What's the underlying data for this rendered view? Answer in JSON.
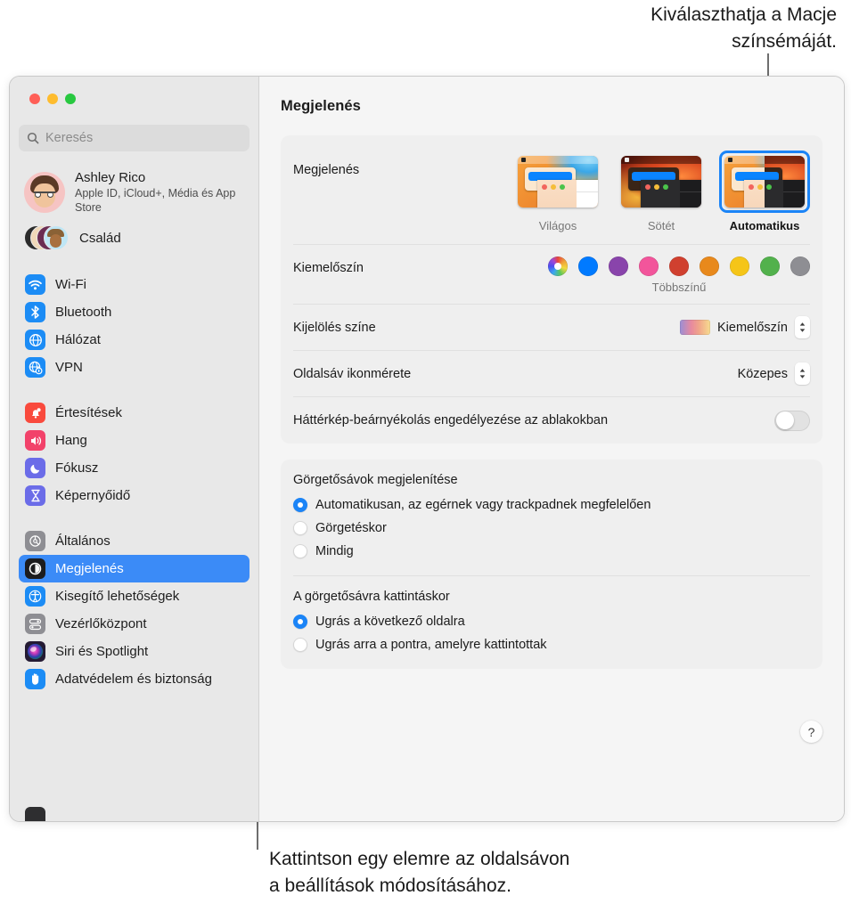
{
  "callouts": {
    "top_line1": "Kiválaszthatja a Macje",
    "top_line2": "színsémáját.",
    "bottom_line1": "Kattintson egy elemre az oldalsávon",
    "bottom_line2": "a beállítások módosításához."
  },
  "window": {
    "title": "Megjelenés"
  },
  "sidebar": {
    "search_placeholder": "Keresés",
    "account": {
      "name": "Ashley Rico",
      "subtitle": "Apple ID, iCloud+, Média és App Store"
    },
    "family_label": "Család",
    "groups": [
      {
        "items": [
          {
            "label": "Wi-Fi",
            "icon": "wifi-icon",
            "color": "#1c8cf5"
          },
          {
            "label": "Bluetooth",
            "icon": "bluetooth-icon",
            "color": "#1c8cf5"
          },
          {
            "label": "Hálózat",
            "icon": "globe-icon",
            "color": "#1c8cf5"
          },
          {
            "label": "VPN",
            "icon": "vpn-globe-icon",
            "color": "#1c8cf5"
          }
        ]
      },
      {
        "items": [
          {
            "label": "Értesítések",
            "icon": "bell-icon",
            "color": "#f94a3d"
          },
          {
            "label": "Hang",
            "icon": "speaker-icon",
            "color": "#f2426a"
          },
          {
            "label": "Fókusz",
            "icon": "moon-icon",
            "color": "#6b6ce8"
          },
          {
            "label": "Képernyőidő",
            "icon": "hourglass-icon",
            "color": "#6b6ce8"
          }
        ]
      },
      {
        "items": [
          {
            "label": "Általános",
            "icon": "gear-icon",
            "color": "#8e8e93"
          },
          {
            "label": "Megjelenés",
            "icon": "appearance-icon",
            "color": "#1c1c1e",
            "selected": true
          },
          {
            "label": "Kisegítő lehetőségek",
            "icon": "accessibility-icon",
            "color": "#1c8cf5"
          },
          {
            "label": "Vezérlőközpont",
            "icon": "control-center-icon",
            "color": "#8e8e93"
          },
          {
            "label": "Siri és Spotlight",
            "icon": "siri-icon",
            "color": "#2b1f3b"
          },
          {
            "label": "Adatvédelem és biztonság",
            "icon": "hand-icon",
            "color": "#1c8cf5"
          }
        ]
      }
    ]
  },
  "main": {
    "appearance": {
      "label": "Megjelenés",
      "options": [
        {
          "name": "Világos",
          "selected": false
        },
        {
          "name": "Sötét",
          "selected": false
        },
        {
          "name": "Automatikus",
          "selected": true
        }
      ]
    },
    "accent": {
      "label": "Kiemelőszín",
      "caption": "Többszínű",
      "colors": [
        {
          "name": "multicolor",
          "hex": "multicolor",
          "selected": true
        },
        {
          "name": "blue",
          "hex": "#007AFF"
        },
        {
          "name": "purple",
          "hex": "#8944AB"
        },
        {
          "name": "pink",
          "hex": "#F2559B"
        },
        {
          "name": "red",
          "hex": "#D0402F"
        },
        {
          "name": "orange",
          "hex": "#E8891C"
        },
        {
          "name": "yellow",
          "hex": "#F5C518"
        },
        {
          "name": "green",
          "hex": "#52B14C"
        },
        {
          "name": "gray",
          "hex": "#8E8E93"
        }
      ]
    },
    "highlight": {
      "label": "Kijelölés színe",
      "value": "Kiemelőszín"
    },
    "sidebar_icon_size": {
      "label": "Oldalsáv ikonmérete",
      "value": "Közepes"
    },
    "wallpaper_tinting": {
      "label": "Háttérkép-beárnyékolás engedélyezése az ablakokban",
      "enabled": false
    },
    "scrollbars": {
      "title": "Görgetősávok megjelenítése",
      "options": [
        {
          "label": "Automatikusan, az egérnek vagy trackpadnek megfelelően",
          "selected": true
        },
        {
          "label": "Görgetéskor",
          "selected": false
        },
        {
          "label": "Mindig",
          "selected": false
        }
      ]
    },
    "scrollbar_click": {
      "title": "A görgetősávra kattintáskor",
      "options": [
        {
          "label": "Ugrás a következő oldalra",
          "selected": true
        },
        {
          "label": "Ugrás arra a pontra, amelyre kattintottak",
          "selected": false
        }
      ]
    },
    "help_label": "?"
  }
}
